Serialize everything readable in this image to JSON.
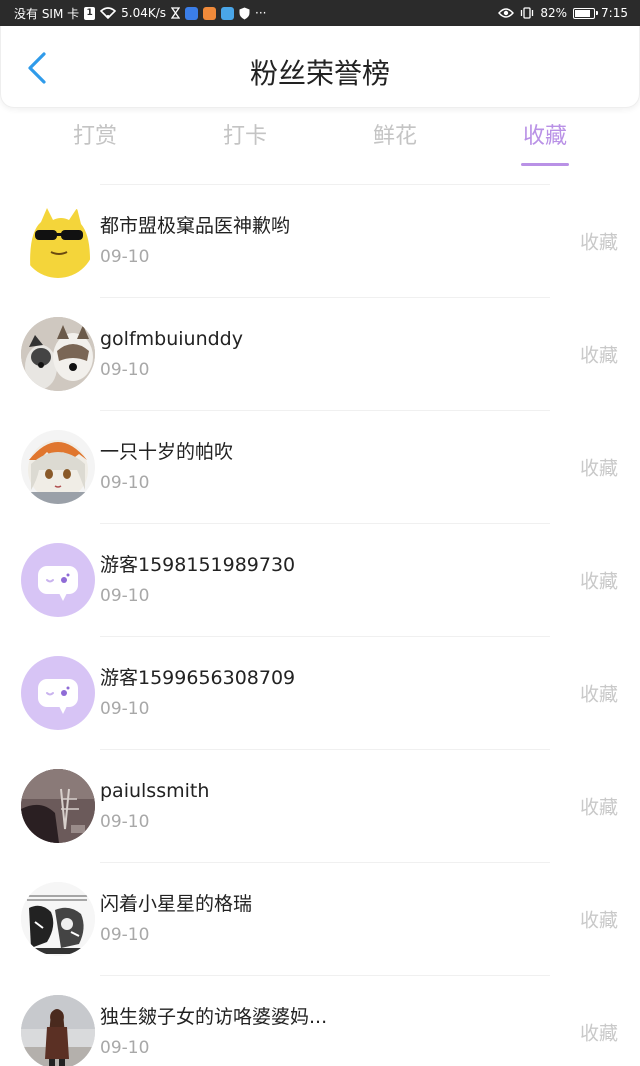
{
  "status_bar": {
    "carrier": "没有 SIM 卡",
    "sim_badge": "1",
    "speed": "5.04K/s",
    "more": "···",
    "battery": "82%",
    "time": "7:15",
    "battery_level": 0.82
  },
  "header": {
    "title": "粉丝荣誉榜"
  },
  "tabs": [
    {
      "label": "打赏",
      "active": false
    },
    {
      "label": "打卡",
      "active": false
    },
    {
      "label": "鲜花",
      "active": false
    },
    {
      "label": "收藏",
      "active": true
    }
  ],
  "accent_color": "#b991e6",
  "items": [
    {
      "name": "都市盟极窠品医神歉哟",
      "date": "09-10",
      "action": "收藏",
      "avatar": "sunglasses-pikachu-avatar"
    },
    {
      "name": "golfmbuiunddy",
      "date": "09-10",
      "action": "收藏",
      "avatar": "husky-dogs-avatar"
    },
    {
      "name": "一只十岁的帕吹",
      "date": "09-10",
      "action": "收藏",
      "avatar": "anime-girl-avatar"
    },
    {
      "name": "游客1598151989730",
      "date": "09-10",
      "action": "收藏",
      "avatar": "default-chat-avatar"
    },
    {
      "name": "游客1599656308709",
      "date": "09-10",
      "action": "收藏",
      "avatar": "default-chat-avatar"
    },
    {
      "name": "paiulssmith",
      "date": "09-10",
      "action": "收藏",
      "avatar": "dark-photo-avatar"
    },
    {
      "name": "闪着小星星的格瑞",
      "date": "09-10",
      "action": "收藏",
      "avatar": "manga-sketch-avatar"
    },
    {
      "name": "独生皴子女的访咯婆婆妈...",
      "date": "09-10",
      "action": "收藏",
      "avatar": "street-photo-avatar"
    }
  ]
}
